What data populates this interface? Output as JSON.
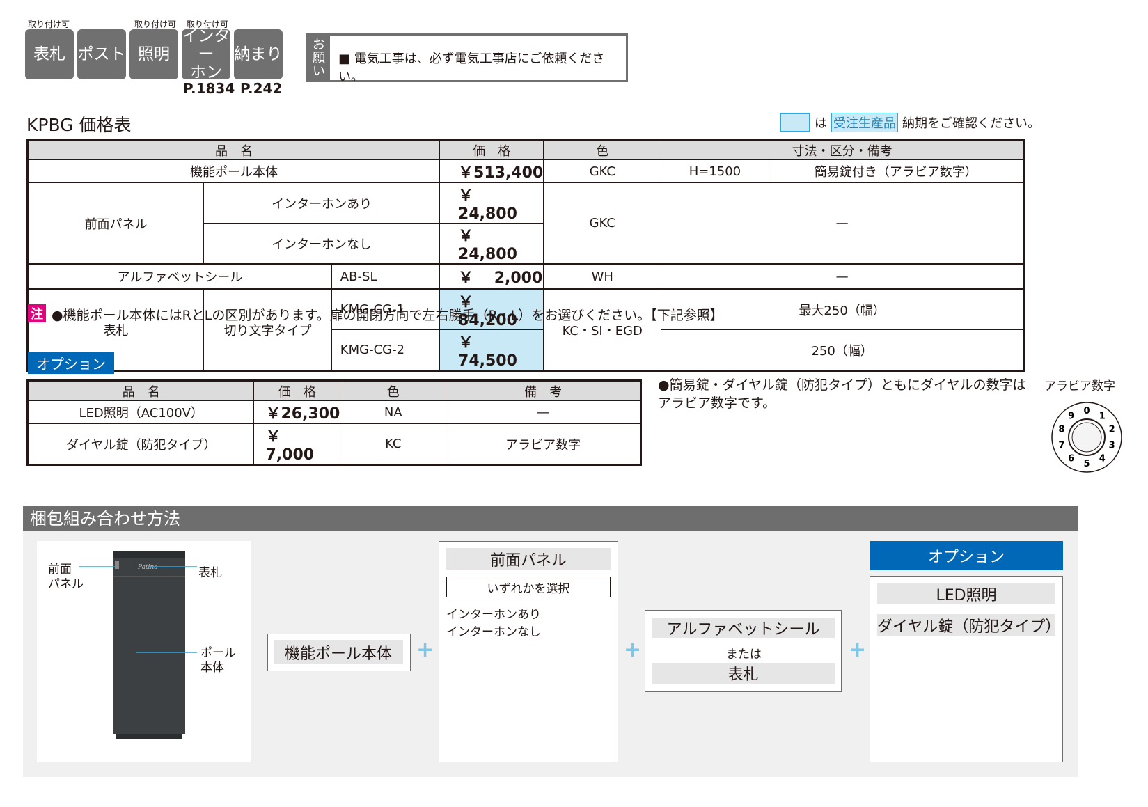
{
  "tabs": [
    {
      "label": "表札",
      "note": "取り付け可"
    },
    {
      "label": "ポスト",
      "note": ""
    },
    {
      "label": "照明",
      "note": "取り付け可"
    },
    {
      "label": "インター\nホン",
      "note": "取り付け可"
    },
    {
      "label": "納まり",
      "note": ""
    }
  ],
  "page_refs": [
    "P.1834",
    "P.242"
  ],
  "notice": {
    "label": [
      "お",
      "願",
      "い"
    ],
    "text": "■ 電気工事は、必ず電気工事店にご依頼ください。"
  },
  "title": "KPBG 価格表",
  "legend": {
    "pre": "は",
    "highlight": "受注生産品",
    "post": "納期をご確認ください。"
  },
  "price_table": {
    "headers": [
      "品　名",
      "価　格",
      "色",
      "寸法・区分・備考"
    ],
    "body_name": "機能ポール本体",
    "body_price": "￥513,400",
    "body_color": "GKC",
    "body_note1": "H=1500",
    "body_note2": "簡易錠付き（アラビア数字）",
    "panel_name": "前面パネル",
    "panel_opt1": "インターホンあり",
    "panel_price1": "￥　24,800",
    "panel_opt2": "インターホンなし",
    "panel_price2": "￥　24,800",
    "panel_color": "GKC",
    "panel_note": "—",
    "seal_name": "アルファベットシール",
    "seal_code": "AB-SL",
    "seal_price": "￥　 2,000",
    "seal_color": "WH",
    "seal_note": "—",
    "plate_name": "表札",
    "plate_type": "切り文字タイプ",
    "plate_code1": "KMG-CG-1",
    "plate_price1": "￥　84,200",
    "plate_code2": "KMG-CG-2",
    "plate_price2": "￥　74,500",
    "plate_color": "KC・SI・EGD",
    "plate_note1": "最大250（幅）",
    "plate_note2": "250（幅）"
  },
  "note": {
    "mark": "注",
    "text": "●機能ポール本体にはRとLの区別があります。扉の開閉方向で左右勝手（R・L）をお選びください。【下記参照】"
  },
  "option_label": "オプション",
  "option_table": {
    "headers": [
      "品　名",
      "価　格",
      "色",
      "備　考"
    ],
    "rows": [
      {
        "name": "LED照明（AC100V）",
        "price": "￥26,300",
        "color": "NA",
        "note": "—"
      },
      {
        "name": "ダイヤル錠（防犯タイプ）",
        "price": "￥　7,000",
        "color": "KC",
        "note": "アラビア数字"
      }
    ]
  },
  "dial_note": "●簡易錠・ダイヤル錠（防犯タイプ）ともにダイヤルの数字はアラビア数字です。",
  "dial_caption": "アラビア数字",
  "dial_digits": [
    "0",
    "1",
    "2",
    "3",
    "4",
    "5",
    "6",
    "7",
    "8",
    "9"
  ],
  "packing": {
    "title": "梱包組み合わせ方法",
    "labels": {
      "panel": "前面\nパネル",
      "plate": "表札",
      "pole": "ポール\n本体"
    },
    "pole_box": "機能ポール本体",
    "panel_box": {
      "title": "前面パネル",
      "select": "いずれかを選択",
      "opt1": "インターホンあり",
      "opt2": "インターホンなし"
    },
    "seal_box": {
      "title": "アルファベットシール",
      "or": "または",
      "plate": "表札"
    },
    "option_box": {
      "title": "オプション",
      "item1": "LED照明",
      "item2": "ダイヤル錠（防犯タイプ）"
    },
    "plus": "+"
  },
  "colors": {
    "tab": "#707070",
    "highlight": "#c9e9f6",
    "option_blue": "#0068b7",
    "note_pink": "#e4007f",
    "plus": "#7fc6e8"
  }
}
